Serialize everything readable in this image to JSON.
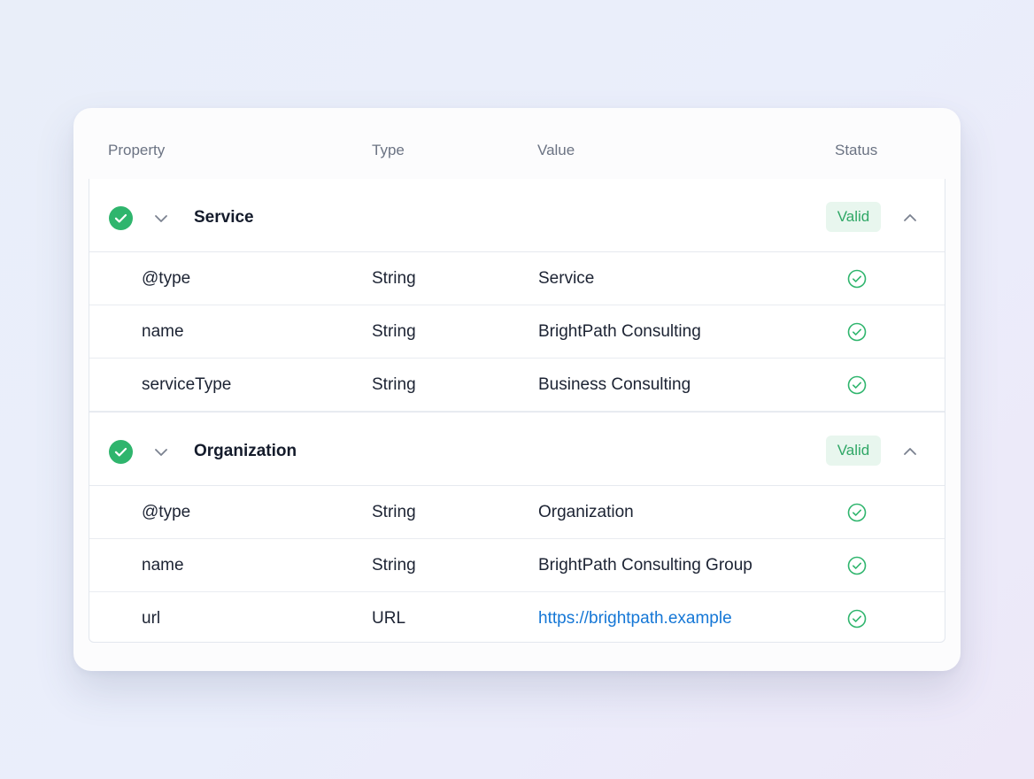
{
  "columns": {
    "property": "Property",
    "type": "Type",
    "value": "Value",
    "status": "Status"
  },
  "colors": {
    "valid_green": "#2fb56d",
    "badge_bg": "#e8f6ee",
    "link_blue": "#1577d6"
  },
  "groups": [
    {
      "label": "Service",
      "status_badge": "Valid",
      "status_icon": "check-circle-filled-icon",
      "expanded": true,
      "rows": [
        {
          "property": "@type",
          "type": "String",
          "value": "Service",
          "status_icon": "check-circle-outline-icon"
        },
        {
          "property": "name",
          "type": "String",
          "value": "BrightPath Consulting",
          "status_icon": "check-circle-outline-icon"
        },
        {
          "property": "serviceType",
          "type": "String",
          "value": "Business Consulting",
          "status_icon": "check-circle-outline-icon"
        }
      ]
    },
    {
      "label": "Organization",
      "status_badge": "Valid",
      "status_icon": "check-circle-filled-icon",
      "expanded": true,
      "rows": [
        {
          "property": "@type",
          "type": "String",
          "value": "Organization",
          "status_icon": "check-circle-outline-icon"
        },
        {
          "property": "name",
          "type": "String",
          "value": "BrightPath Consulting Group",
          "status_icon": "check-circle-outline-icon"
        },
        {
          "property": "url",
          "type": "URL",
          "value": "https://brightpath.example",
          "status_icon": "check-circle-outline-icon"
        }
      ]
    }
  ]
}
